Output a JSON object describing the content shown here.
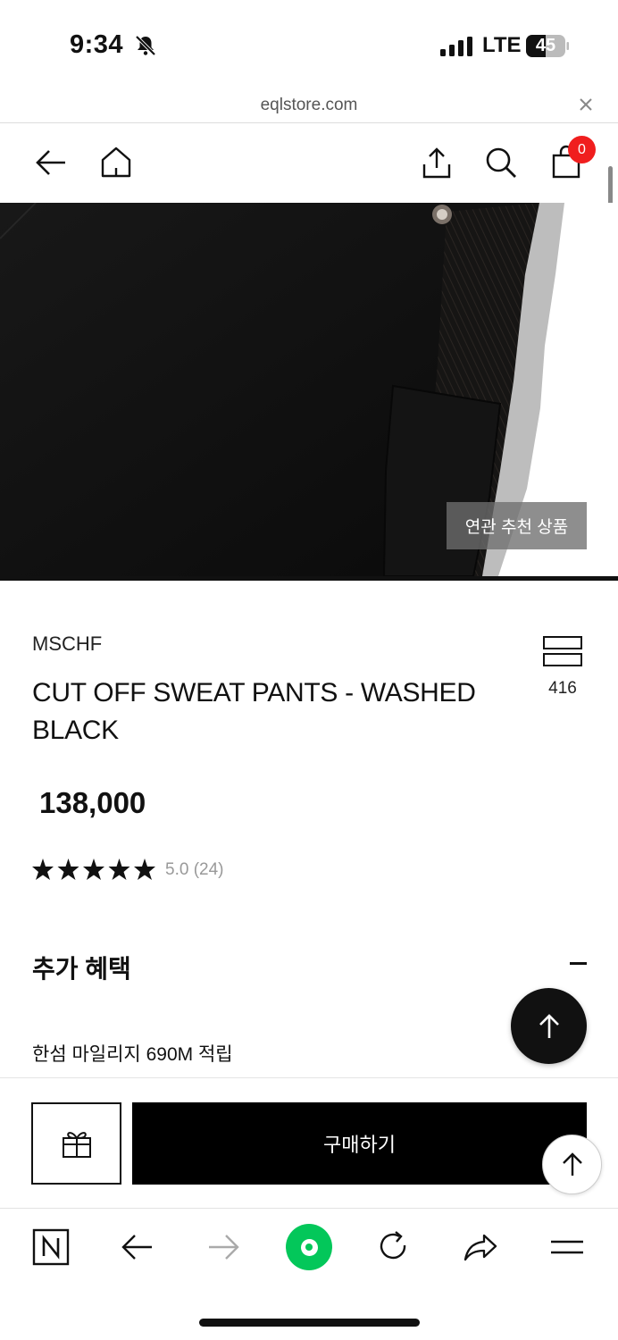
{
  "status_bar": {
    "time": "9:34",
    "network": "LTE",
    "battery": "45"
  },
  "url_bar": {
    "url": "eqlstore.com"
  },
  "nav": {
    "cart_count": "0"
  },
  "hero": {
    "related_button": "연관 추천 상품"
  },
  "product": {
    "brand": "MSCHF",
    "title": "CUT OFF SWEAT PANTS - WASHED BLACK",
    "price": "138,000",
    "rating_text": "5.0 (24)",
    "rating": 5,
    "compare_count": "416"
  },
  "benefits": {
    "title": "추가 혜택",
    "mileage": "한섬 마일리지 690M 적립"
  },
  "purchase": {
    "buy_label": "구매하기"
  },
  "colors": {
    "badge": "#f01e1e",
    "naver_green": "#03c75a",
    "primary": "#000000"
  }
}
